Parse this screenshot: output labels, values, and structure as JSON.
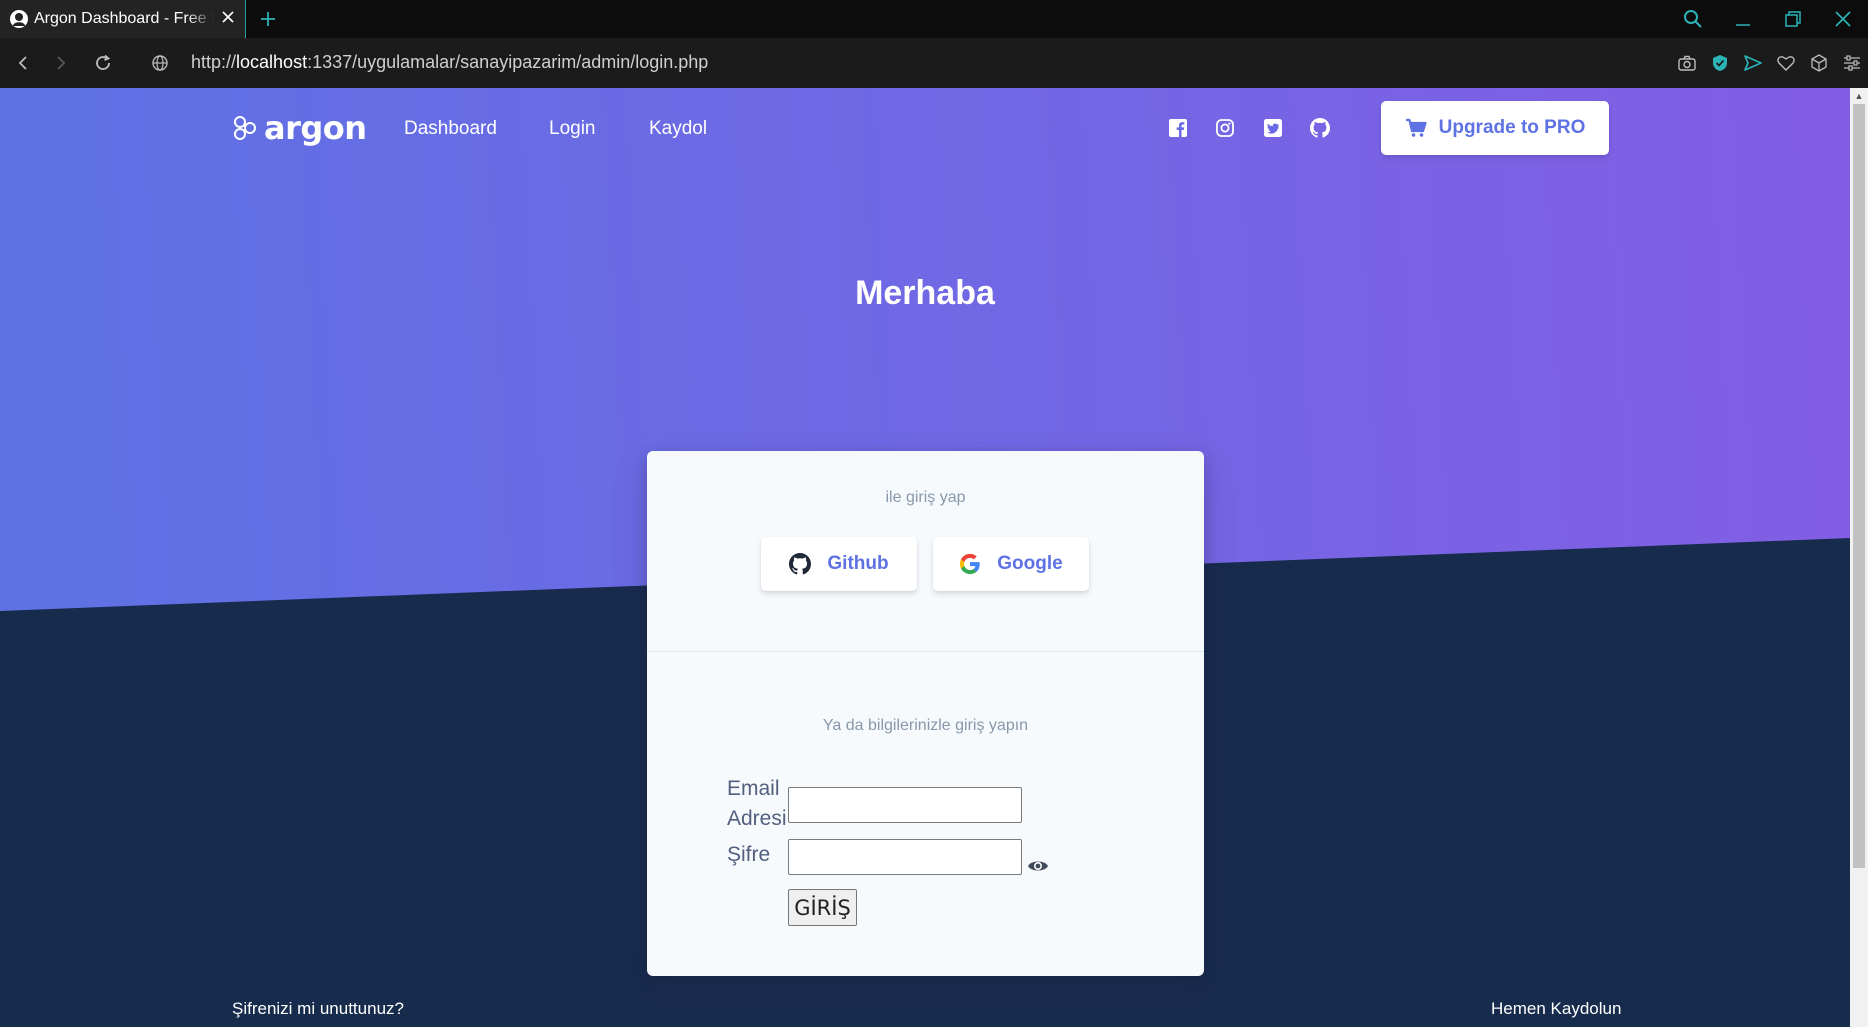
{
  "browser": {
    "tab_title": "Argon Dashboard - Free Da",
    "url_prefix": "http://",
    "url_host": "localhost",
    "url_rest": ":1337/uygulamalar/sanayipazarim/admin/login.php"
  },
  "navbar": {
    "brand": "argon",
    "links": [
      "Dashboard",
      "Login",
      "Kaydol"
    ],
    "social_icons": [
      "facebook-icon",
      "instagram-icon",
      "twitter-icon",
      "github-icon"
    ],
    "pro_button": "Upgrade to PRO"
  },
  "hero": {
    "title": "Merhaba"
  },
  "login_card": {
    "social_heading": "ile giriş yap",
    "github_label": "Github",
    "google_label": "Google",
    "form_heading": "Ya da bilgilerinizle giriş yapın",
    "email_label_line1": "Email",
    "email_label_line2": "Adresi",
    "email_value": "",
    "password_label": "Şifre",
    "password_value": "",
    "submit_label": "GİRİŞ"
  },
  "footer": {
    "forgot_password": "Şifrenizi mi unuttunuz?",
    "register_now": "Hemen Kaydolun"
  },
  "colors": {
    "primary": "#5e72e4",
    "gradient_end": "#825ee4",
    "default_bg": "#172b4d",
    "card_bg": "#f7fafc",
    "browser_accent": "#2bb3b8"
  }
}
